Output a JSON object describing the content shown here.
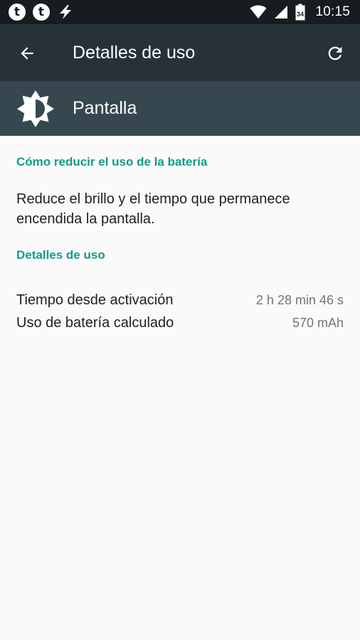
{
  "status_bar": {
    "notifications": [
      {
        "icon": "tumblr-icon",
        "glyph": "t"
      },
      {
        "icon": "tumblr-icon",
        "glyph": "t"
      },
      {
        "icon": "flash-icon",
        "glyph": ""
      }
    ],
    "signal_icons": [
      "wifi-icon",
      "cell-signal-icon",
      "battery-icon"
    ],
    "battery_level": "34",
    "time": "10:15"
  },
  "app_bar": {
    "back_icon": "arrow-back-icon",
    "title": "Detalles de uso",
    "refresh_icon": "refresh-icon"
  },
  "header": {
    "icon": "brightness-icon",
    "title": "Pantalla"
  },
  "tips": {
    "title": "Cómo reducir el uso de la batería",
    "text": "Reduce el brillo y el tiempo que permanece encendida la pantalla."
  },
  "details": {
    "title": "Detalles de uso",
    "rows": [
      {
        "label": "Tiempo desde activación",
        "value": "2 h 28 min 46 s"
      },
      {
        "label": "Uso de batería calculado",
        "value": "570 mAh"
      }
    ]
  },
  "colors": {
    "status_bar": "#161c1f",
    "app_bar": "#263238",
    "header_bar": "#37474f",
    "accent": "#149b8a",
    "background": "#fafafa"
  }
}
